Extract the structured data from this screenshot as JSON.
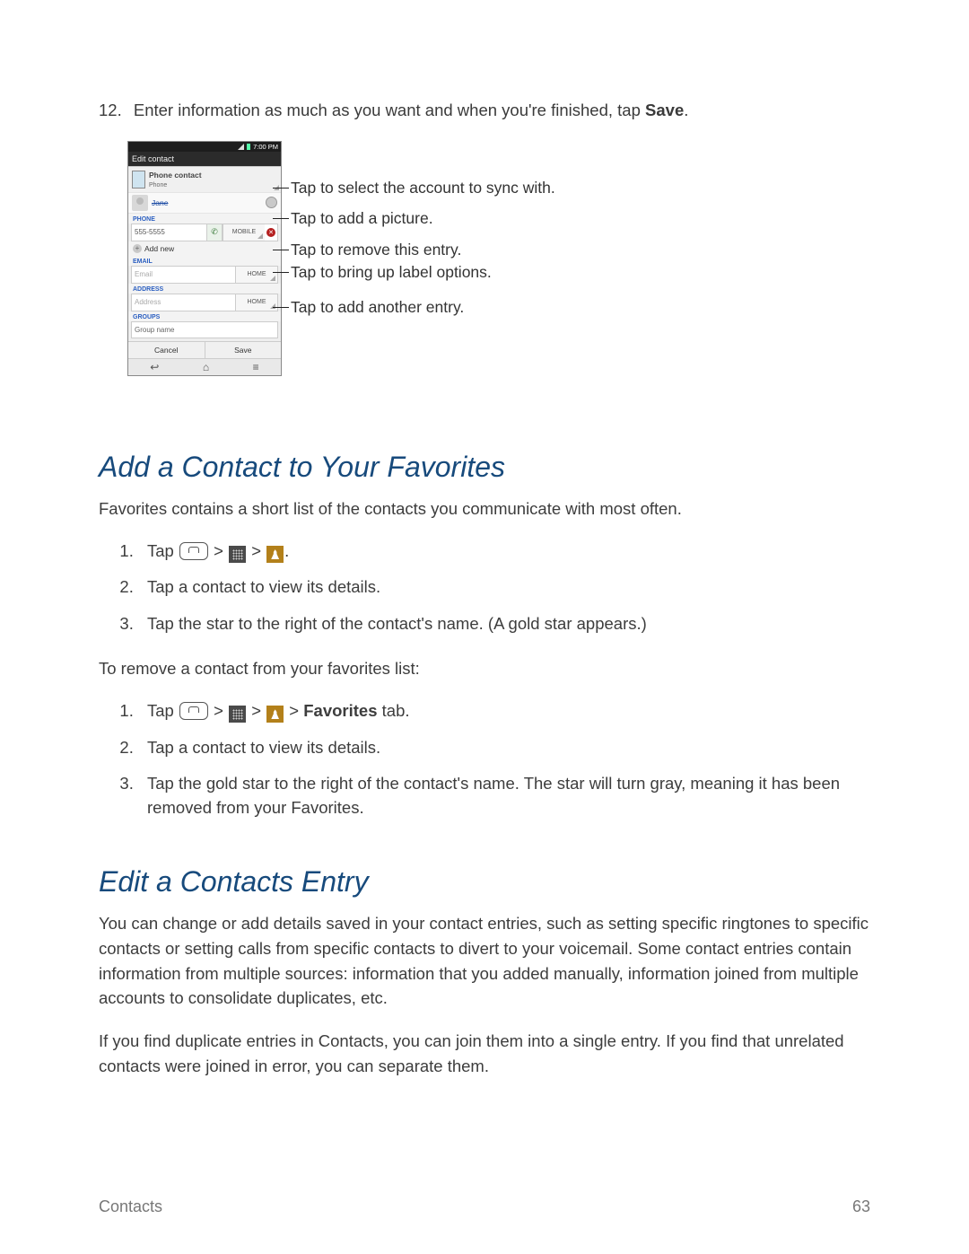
{
  "step12": {
    "num": "12.",
    "text_a": "Enter information as much as you want and when you're finished, tap ",
    "text_b": "Save",
    "text_c": "."
  },
  "screenshot": {
    "time": "7:00 PM",
    "title": "Edit contact",
    "account_label": "Phone contact",
    "account_sub": "Phone",
    "name_value": "Jane",
    "section_phone": "PHONE",
    "phone_value": "555-5555",
    "phone_label": "MOBILE",
    "add_new": "Add new",
    "section_email": "EMAIL",
    "email_placeholder": "Email",
    "email_label": "HOME",
    "section_address": "ADDRESS",
    "address_placeholder": "Address",
    "address_label": "HOME",
    "section_groups": "GROUPS",
    "group_placeholder": "Group name",
    "btn_cancel": "Cancel",
    "btn_save": "Save"
  },
  "callouts": {
    "c1": "Tap to select the account to sync with.",
    "c2": "Tap to add a picture.",
    "c3": "Tap to remove this entry.",
    "c4": "Tap to bring up label options.",
    "c5": "Tap to add another entry."
  },
  "fav": {
    "heading": "Add a Contact to Your Favorites",
    "intro": "Favorites contains a short list of the contacts you communicate with most often.",
    "s1a": "Tap ",
    "s1b": " > ",
    "s1c": " > ",
    "s1d": ".",
    "s2": "Tap a contact to view its details.",
    "s3": "Tap the star to the right of the contact's name. (A gold star appears.)",
    "remove_intro": "To remove a contact from your favorites list:",
    "r1a": "Tap ",
    "r1b": " > ",
    "r1c": " > ",
    "r1d": " > ",
    "r1e": "Favorites",
    "r1f": " tab.",
    "r2": "Tap a contact to view its details.",
    "r3": "Tap the gold star to the right of the contact's name. The star will turn gray, meaning it has been removed from your Favorites."
  },
  "edit": {
    "heading": "Edit a Contacts Entry",
    "p1": "You can change or add details saved in your contact entries, such as setting specific ringtones to specific contacts or setting calls from specific contacts to divert to your voicemail. Some contact entries contain information from multiple sources: information that you added manually, information joined from multiple accounts to consolidate duplicates, etc.",
    "p2": "If you find duplicate entries in Contacts, you can join them into a single entry. If you find that unrelated contacts were joined in error, you can separate them."
  },
  "footer": {
    "left": "Contacts",
    "right": "63"
  }
}
